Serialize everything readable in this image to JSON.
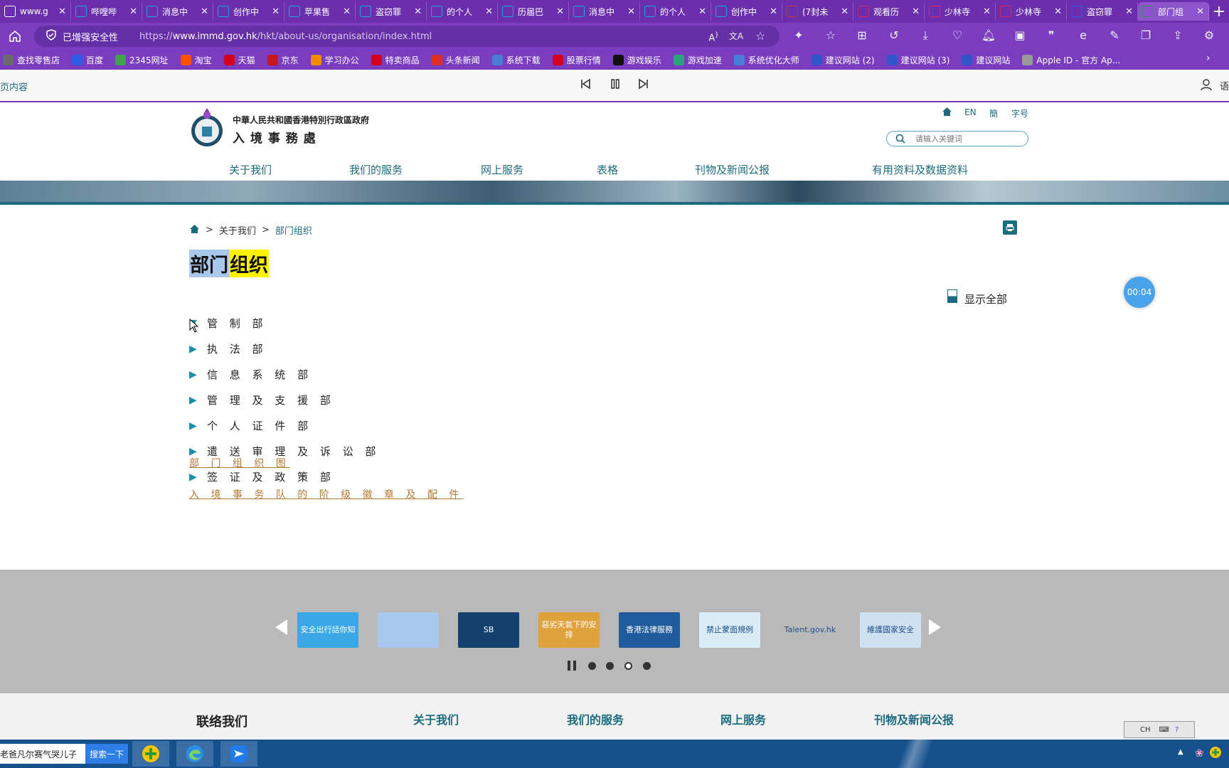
{
  "browser": {
    "tabs": [
      {
        "label": "www.g",
        "icon": "generic",
        "color": "#ffffff"
      },
      {
        "label": "哔哩哔",
        "icon": "bilibili",
        "color": "#1aa5e6"
      },
      {
        "label": "消息中",
        "icon": "bilibili",
        "color": "#1aa5e6"
      },
      {
        "label": "创作中",
        "icon": "bilibili",
        "color": "#1aa5e6"
      },
      {
        "label": "苹果售",
        "icon": "bilibili",
        "color": "#1aa5e6"
      },
      {
        "label": "盗窃罪",
        "icon": "bilibili",
        "color": "#1aa5e6"
      },
      {
        "label": "的个人",
        "icon": "bilibili",
        "color": "#1aa5e6"
      },
      {
        "label": "历届巴",
        "icon": "bilibili",
        "color": "#1aa5e6"
      },
      {
        "label": "消息中",
        "icon": "bilibili",
        "color": "#1aa5e6"
      },
      {
        "label": "的个人",
        "icon": "bilibili",
        "color": "#1aa5e6"
      },
      {
        "label": "创作中",
        "icon": "bilibili",
        "color": "#1aa5e6"
      },
      {
        "label": "(7封未",
        "icon": "mail",
        "color": "#c0392b"
      },
      {
        "label": "观看历",
        "icon": "video",
        "color": "#e0245e"
      },
      {
        "label": "少林寺",
        "icon": "video",
        "color": "#e0245e"
      },
      {
        "label": "少林寺",
        "icon": "video",
        "color": "#e0245e"
      },
      {
        "label": "盗窃罪",
        "icon": "baidu",
        "color": "#2d5be3"
      },
      {
        "label": "部门组",
        "icon": "immd",
        "color": "#3a8a5c",
        "active": true
      }
    ],
    "security_label": "已增强安全性",
    "url_prefix": "https://",
    "url_domain": "www.immd.gov.hk",
    "url_path": "/hkt/about-us/organisation/index.html",
    "bookmarks": [
      {
        "label": "查找零售店",
        "color": "#6b6b6b"
      },
      {
        "label": "百度",
        "color": "#2d5be3"
      },
      {
        "label": "2345网址",
        "color": "#3fa34d"
      },
      {
        "label": "淘宝",
        "color": "#ff5000"
      },
      {
        "label": "天猫",
        "color": "#d4001f"
      },
      {
        "label": "京东",
        "color": "#c9151e"
      },
      {
        "label": "学习办公",
        "color": "#f08c00"
      },
      {
        "label": "特卖商品",
        "color": "#d4001f"
      },
      {
        "label": "头条新闻",
        "color": "#e02e24"
      },
      {
        "label": "系统下载",
        "color": "#4a7dd9"
      },
      {
        "label": "股票行情",
        "color": "#d4001f"
      },
      {
        "label": "游戏娱乐",
        "color": "#111111"
      },
      {
        "label": "游戏加速",
        "color": "#29a37a"
      },
      {
        "label": "系统优化大师",
        "color": "#4a7dd9"
      },
      {
        "label": "建议网站 (2)",
        "color": "#2f55c9"
      },
      {
        "label": "建议网站 (3)",
        "color": "#2f55c9"
      },
      {
        "label": "建议网站",
        "color": "#2f55c9"
      },
      {
        "label": "Apple ID - 官方 Ap...",
        "color": "#999999"
      }
    ],
    "reader": {
      "left_label": "页内容",
      "right_label": "语"
    }
  },
  "site": {
    "gov_name": "中華人民共和國香港特別行政區政府",
    "dept_name": "入 境 事 務 處",
    "lang_en": "EN",
    "lang_sc": "簡",
    "font_size": "字号",
    "search_placeholder": "请输入关键词",
    "nav": [
      "关于我们",
      "我们的服务",
      "网上服务",
      "表格",
      "刊物及新闻公报",
      "有用资料及数据资料"
    ],
    "breadcrumb": {
      "level1": "关于我们",
      "level2": "部门组织"
    },
    "title_part1": "部门",
    "title_part2": "组织",
    "show_all": "显示全部",
    "timer": "00:04",
    "departments": [
      "管 制 部",
      "执 法 部",
      "信 息 系 统 部",
      "管 理 及 支 援 部",
      "个 人 证 件 部",
      "遣 送 审 理 及 诉 讼 部",
      "签 证 及 政 策 部"
    ],
    "links": [
      "部 门 组 织 图",
      "入 境 事 务 队 的 阶 级 徽 章 及 配 件"
    ],
    "banners": [
      {
        "text": "安全出行話你知",
        "color": "#3aa7e6"
      },
      {
        "text": "",
        "color": "#a8c6ee"
      },
      {
        "text": "SB",
        "color": "#14426e"
      },
      {
        "text": "惡劣天氣下的安排",
        "color": "#e0a23d"
      },
      {
        "text": "香港法律服務",
        "color": "#1f5b9d"
      },
      {
        "text": "禁止蒙面規例",
        "color": "#d9ecf6"
      },
      {
        "text": "Talent.gov.hk",
        "color": "#b9b9b9"
      },
      {
        "text": "維護國家安全",
        "color": "#cfe1f0"
      }
    ],
    "footer": {
      "contact": "联络我们",
      "cols": [
        "关于我们",
        "我们的服务",
        "网上服务",
        "刊物及新闻公报"
      ]
    }
  },
  "taskbar": {
    "news_text": "老爸凡尔赛气哭儿子",
    "search_button": "搜索一下",
    "ime": "CH"
  },
  "colors": {
    "browser_purple": "#7a3dc0",
    "tab_purple": "#6b2fae",
    "site_teal": "#1d6b7e",
    "link_orange": "#b37a33",
    "highlight_yellow": "#fff200",
    "highlight_blue": "#a9c8ec"
  }
}
